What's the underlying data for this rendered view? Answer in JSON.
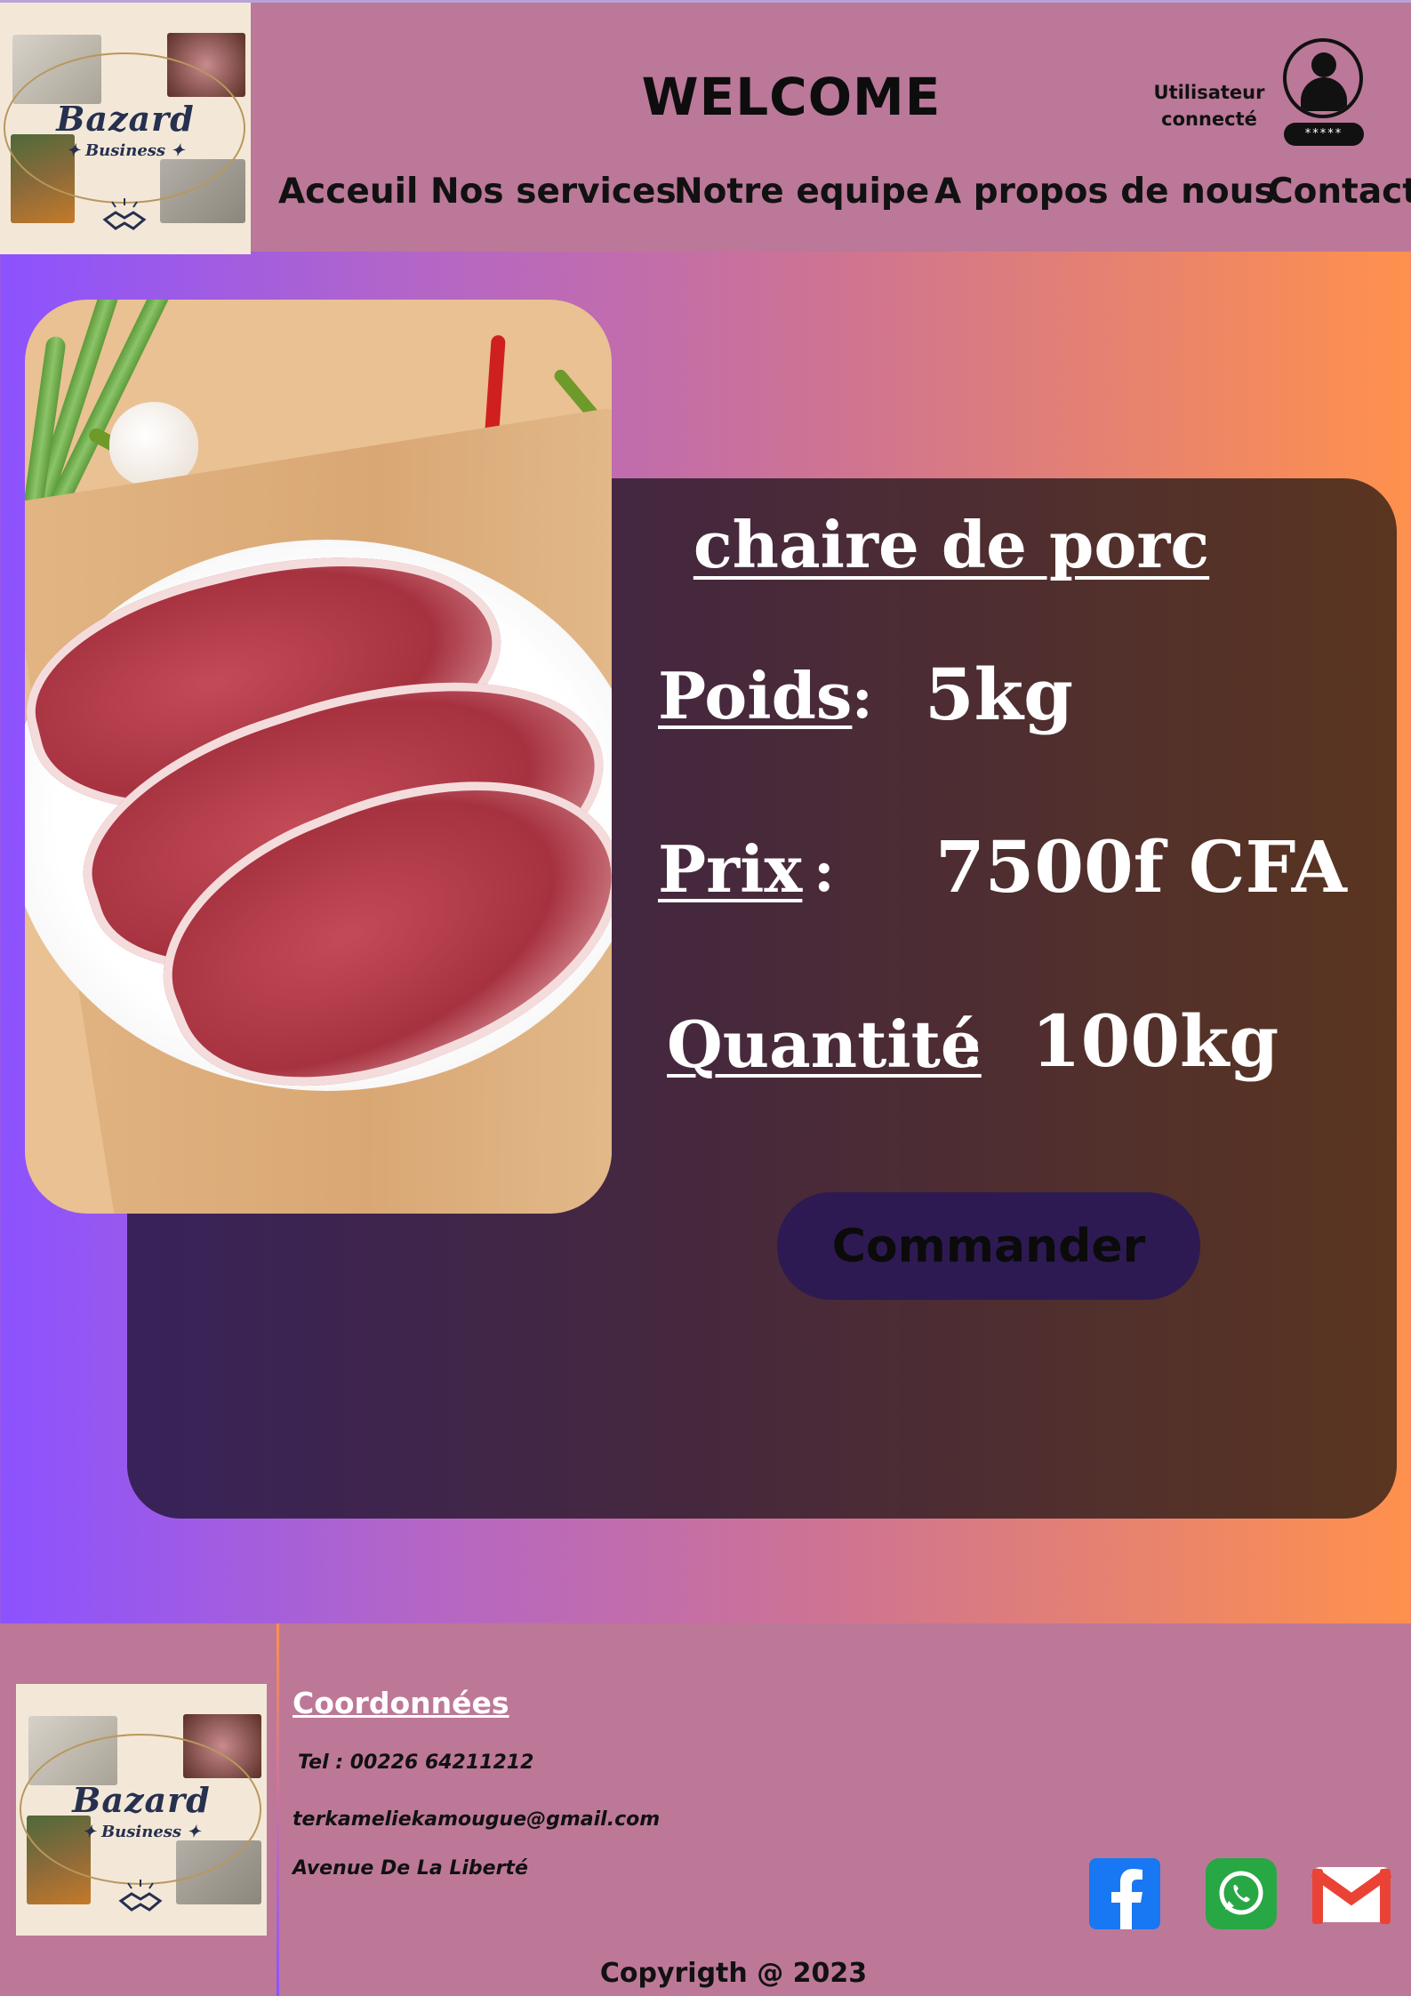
{
  "header": {
    "logo": {
      "title": "Bazard",
      "subtitle": "✦ Business ✦"
    },
    "welcome": "WELCOME",
    "user": {
      "status_line1": "Utilisateur",
      "status_line2": "connecté",
      "password_mask": "*****"
    },
    "nav": [
      "Acceuil",
      "Nos services",
      "Notre equipe",
      "A propos de nous",
      "Contact"
    ]
  },
  "product": {
    "name": "chaire de porc",
    "weight_label": "Poids",
    "weight_value": "5kg",
    "price_label": "Prix",
    "price_value": "7500f CFA",
    "quantity_label": "Quantité",
    "quantity_value": "100kg",
    "separator": ":",
    "order_button": "Commander"
  },
  "footer": {
    "coord_title": "Coordonnées",
    "tel": "Tel : 00226 64211212",
    "email": "terkameliekamougue@gmail.com",
    "address": "Avenue De La Liberté",
    "copyright": "Copyrigth @ 2023"
  },
  "colors": {
    "header_bg": "#bb7898",
    "card_start": "#38225a",
    "card_end": "#5a3520",
    "button_bg": "#2e1a52",
    "gradient_left": "#8c52ff",
    "gradient_right": "#ff914d"
  },
  "icons": [
    "user-avatar-icon",
    "handshake-icon",
    "facebook-icon",
    "whatsapp-icon",
    "gmail-icon"
  ]
}
